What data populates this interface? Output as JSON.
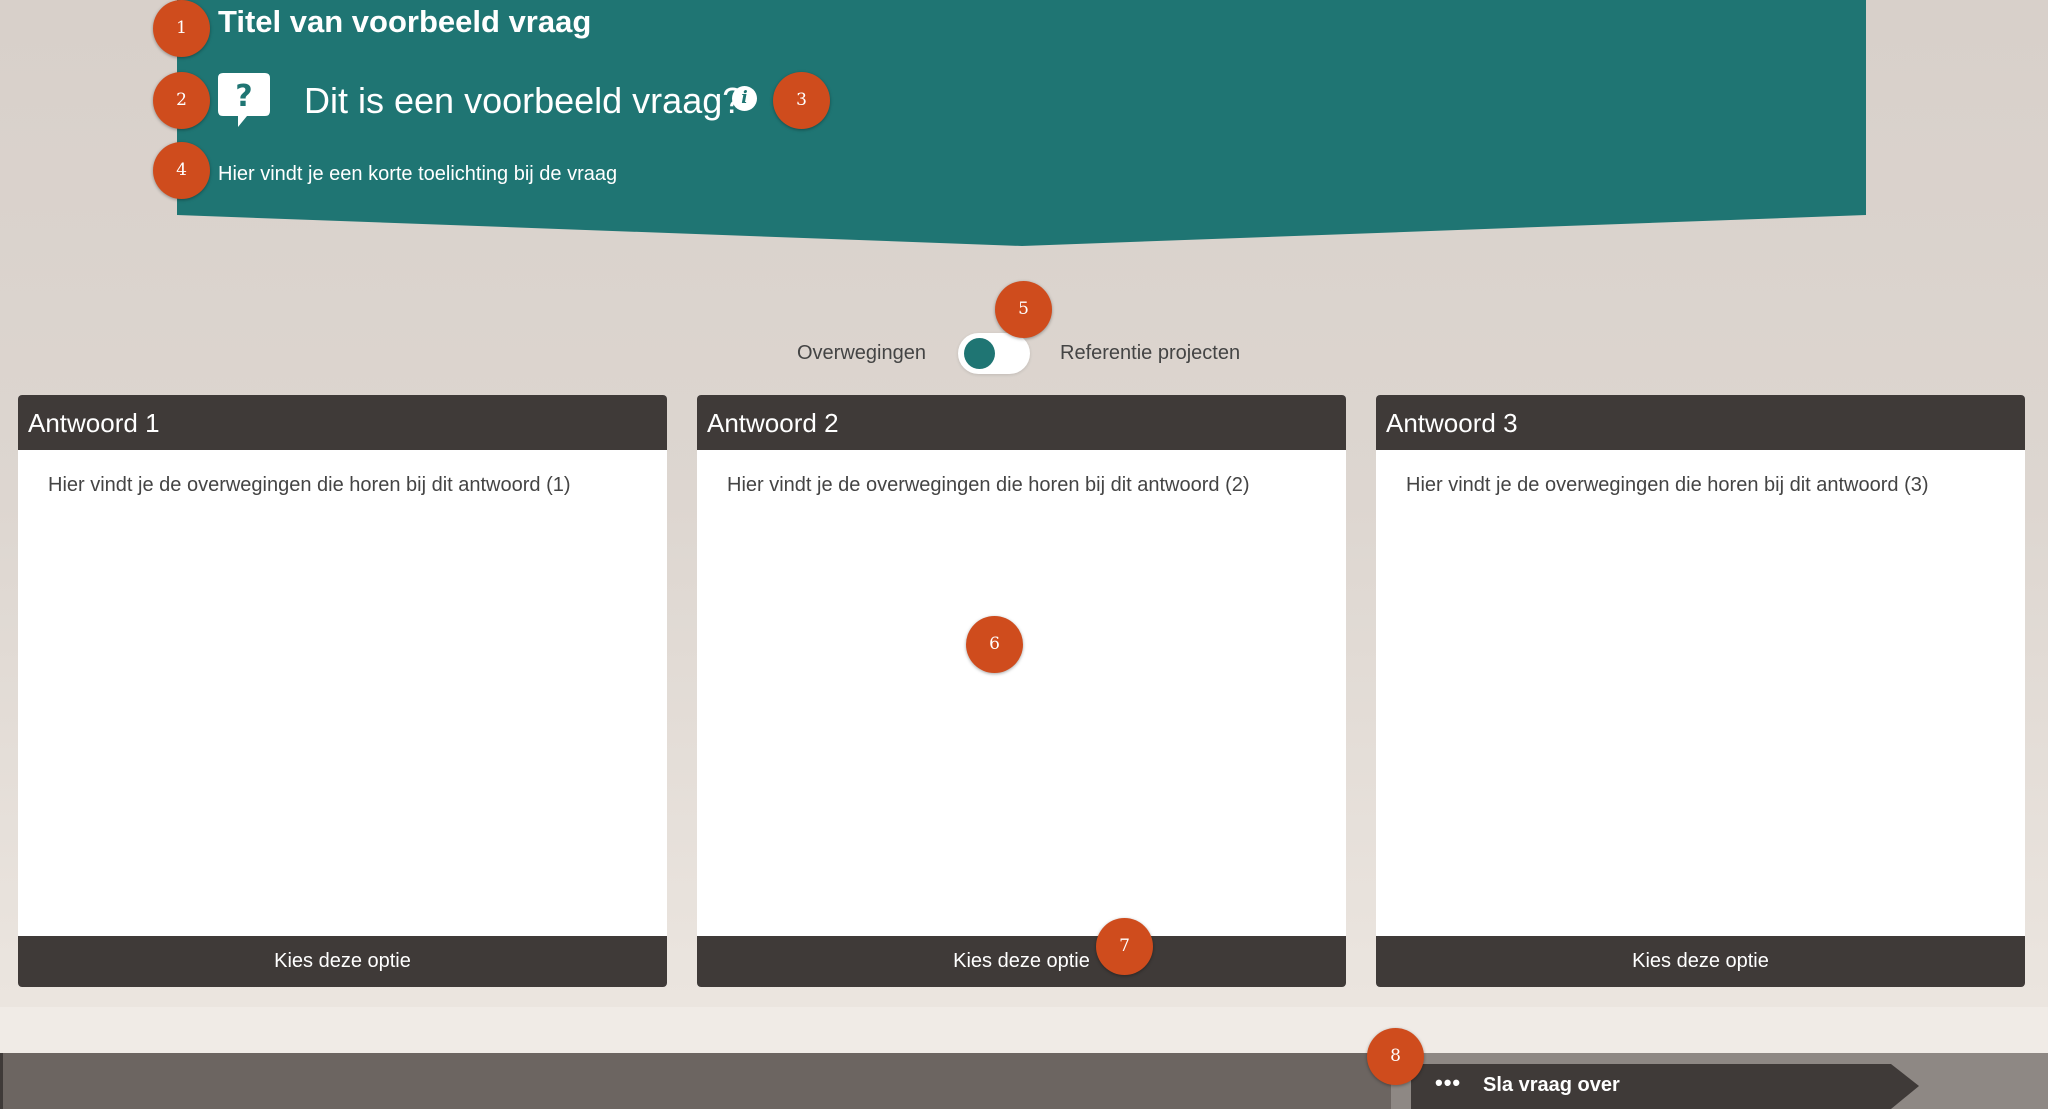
{
  "question": {
    "title": "Titel van voorbeeld vraag",
    "text": "Dit is een voorbeeld vraag?",
    "info_glyph": "i",
    "description": "Hier vindt je een korte toelichting bij de vraag"
  },
  "toggle": {
    "left_label": "Overwegingen",
    "right_label": "Referentie projecten"
  },
  "answers": [
    {
      "title": "Antwoord 1",
      "body": "Hier vindt je de overwegingen die horen bij dit antwoord (1)",
      "button": "Kies deze optie"
    },
    {
      "title": "Antwoord 2",
      "body": "Hier vindt je de overwegingen die horen bij dit antwoord (2)",
      "button": "Kies deze optie"
    },
    {
      "title": "Antwoord 3",
      "body": "Hier vindt je de overwegingen die horen bij dit antwoord (3)",
      "button": "Kies deze optie"
    }
  ],
  "skip": {
    "dots": "•••",
    "label": "Sla vraag over"
  },
  "markers": [
    "1",
    "2",
    "3",
    "4",
    "5",
    "6",
    "7",
    "8"
  ],
  "colors": {
    "teal": "#1f7573",
    "dark": "#3f3a38",
    "marker": "#cf4c1d"
  },
  "icons": {
    "question": "speech-bubble-question-icon",
    "info": "info-icon",
    "skip": "ellipsis-icon"
  }
}
